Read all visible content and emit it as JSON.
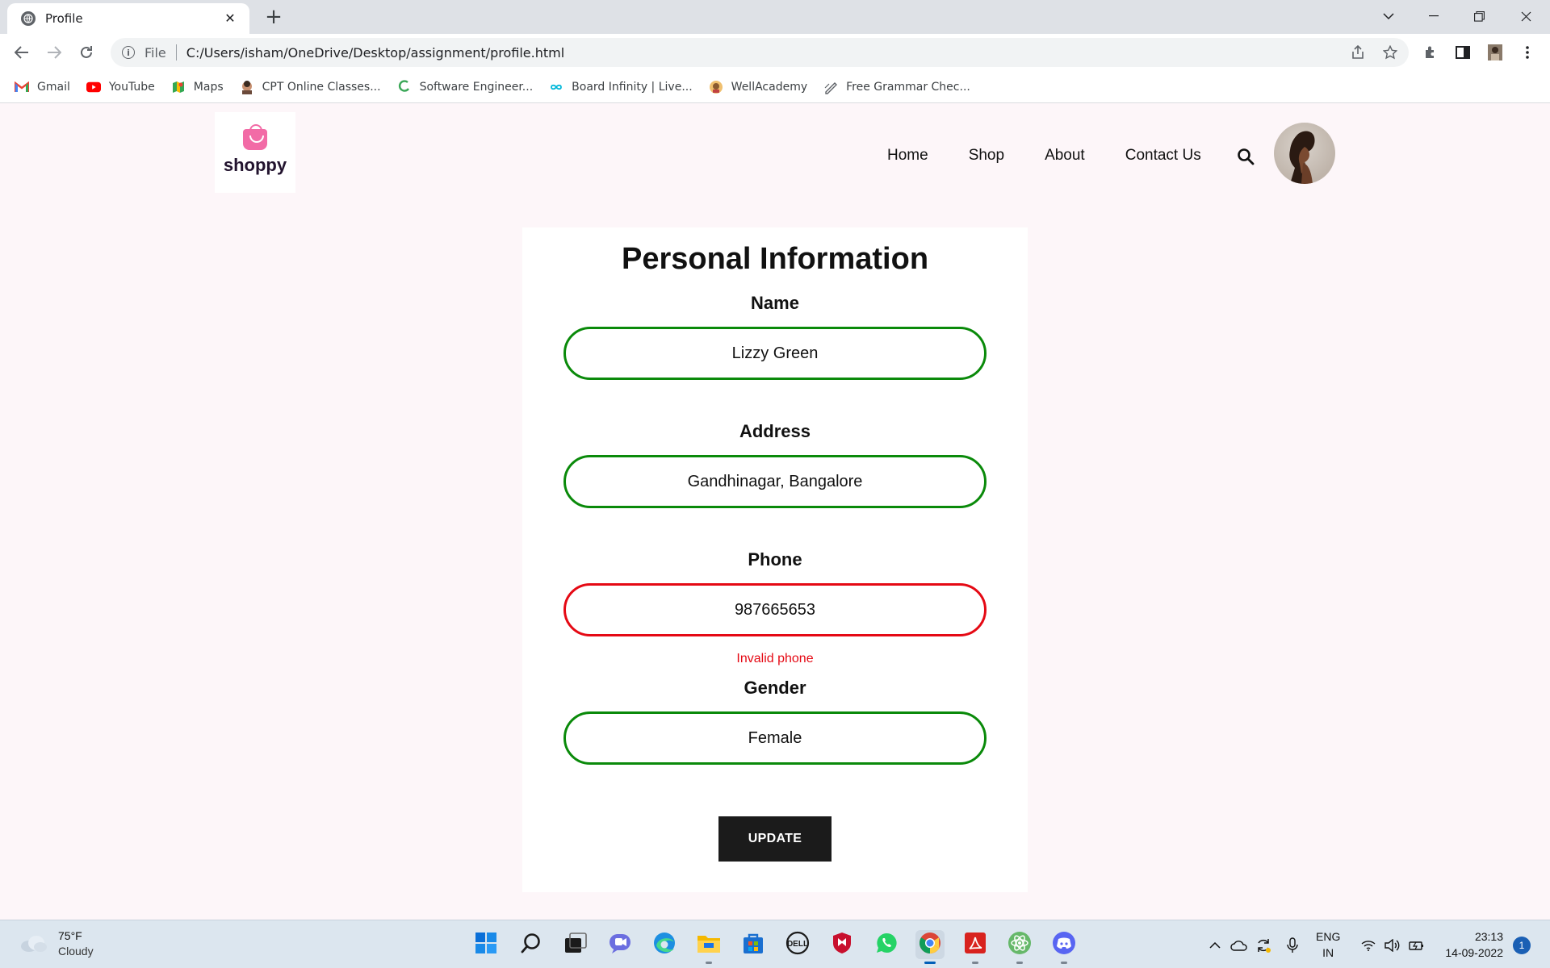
{
  "browser": {
    "tab_title": "Profile",
    "address_scheme": "File",
    "address_url": "C:/Users/isham/OneDrive/Desktop/assignment/profile.html",
    "bookmarks": [
      {
        "label": "Gmail",
        "icon": "gmail-icon",
        "color": "#ea4335"
      },
      {
        "label": "YouTube",
        "icon": "youtube-icon",
        "color": "#ff0000"
      },
      {
        "label": "Maps",
        "icon": "maps-icon",
        "color": "#34a853"
      },
      {
        "label": "CPT Online Classes...",
        "icon": "cpt-icon",
        "color": "#8d5a3c"
      },
      {
        "label": "Software Engineer...",
        "icon": "software-engineer-icon",
        "color": "#3aa757"
      },
      {
        "label": "Board Infinity | Live...",
        "icon": "board-infinity-icon",
        "color": "#00b8d9"
      },
      {
        "label": "WellAcademy",
        "icon": "wellacademy-icon",
        "color": "#e0a030"
      },
      {
        "label": "Free Grammar Chec...",
        "icon": "grammar-icon",
        "color": "#5f6368"
      }
    ]
  },
  "site": {
    "brand": "shoppy",
    "nav": [
      "Home",
      "Shop",
      "About",
      "Contact Us"
    ],
    "accent": "#f26ba6"
  },
  "form": {
    "heading": "Personal Information",
    "fields": [
      {
        "label": "Name",
        "value": "Lizzy Green",
        "valid": true
      },
      {
        "label": "Address",
        "value": "Gandhinagar, Bangalore",
        "valid": true
      },
      {
        "label": "Phone",
        "value": "987665653",
        "valid": false,
        "error": "Invalid phone"
      },
      {
        "label": "Gender",
        "value": "Female",
        "valid": true
      }
    ],
    "submit_label": "UPDATE",
    "valid_color": "#0a8a0a",
    "invalid_color": "#e50914"
  },
  "taskbar": {
    "weather_temp": "75°F",
    "weather_desc": "Cloudy",
    "lang_line1": "ENG",
    "lang_line2": "IN",
    "time": "23:13",
    "date": "14-09-2022",
    "notification_count": "1"
  }
}
